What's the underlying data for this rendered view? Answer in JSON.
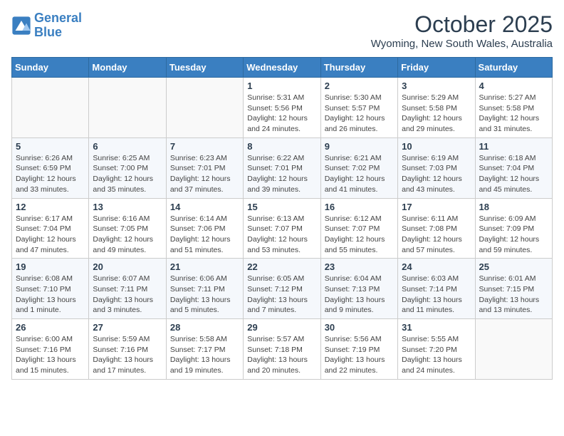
{
  "header": {
    "logo_line1": "General",
    "logo_line2": "Blue",
    "month": "October 2025",
    "location": "Wyoming, New South Wales, Australia"
  },
  "weekdays": [
    "Sunday",
    "Monday",
    "Tuesday",
    "Wednesday",
    "Thursday",
    "Friday",
    "Saturday"
  ],
  "weeks": [
    [
      {
        "day": "",
        "info": ""
      },
      {
        "day": "",
        "info": ""
      },
      {
        "day": "",
        "info": ""
      },
      {
        "day": "1",
        "info": "Sunrise: 5:31 AM\nSunset: 5:56 PM\nDaylight: 12 hours and 24 minutes."
      },
      {
        "day": "2",
        "info": "Sunrise: 5:30 AM\nSunset: 5:57 PM\nDaylight: 12 hours and 26 minutes."
      },
      {
        "day": "3",
        "info": "Sunrise: 5:29 AM\nSunset: 5:58 PM\nDaylight: 12 hours and 29 minutes."
      },
      {
        "day": "4",
        "info": "Sunrise: 5:27 AM\nSunset: 5:58 PM\nDaylight: 12 hours and 31 minutes."
      }
    ],
    [
      {
        "day": "5",
        "info": "Sunrise: 6:26 AM\nSunset: 6:59 PM\nDaylight: 12 hours and 33 minutes."
      },
      {
        "day": "6",
        "info": "Sunrise: 6:25 AM\nSunset: 7:00 PM\nDaylight: 12 hours and 35 minutes."
      },
      {
        "day": "7",
        "info": "Sunrise: 6:23 AM\nSunset: 7:01 PM\nDaylight: 12 hours and 37 minutes."
      },
      {
        "day": "8",
        "info": "Sunrise: 6:22 AM\nSunset: 7:01 PM\nDaylight: 12 hours and 39 minutes."
      },
      {
        "day": "9",
        "info": "Sunrise: 6:21 AM\nSunset: 7:02 PM\nDaylight: 12 hours and 41 minutes."
      },
      {
        "day": "10",
        "info": "Sunrise: 6:19 AM\nSunset: 7:03 PM\nDaylight: 12 hours and 43 minutes."
      },
      {
        "day": "11",
        "info": "Sunrise: 6:18 AM\nSunset: 7:04 PM\nDaylight: 12 hours and 45 minutes."
      }
    ],
    [
      {
        "day": "12",
        "info": "Sunrise: 6:17 AM\nSunset: 7:04 PM\nDaylight: 12 hours and 47 minutes."
      },
      {
        "day": "13",
        "info": "Sunrise: 6:16 AM\nSunset: 7:05 PM\nDaylight: 12 hours and 49 minutes."
      },
      {
        "day": "14",
        "info": "Sunrise: 6:14 AM\nSunset: 7:06 PM\nDaylight: 12 hours and 51 minutes."
      },
      {
        "day": "15",
        "info": "Sunrise: 6:13 AM\nSunset: 7:07 PM\nDaylight: 12 hours and 53 minutes."
      },
      {
        "day": "16",
        "info": "Sunrise: 6:12 AM\nSunset: 7:07 PM\nDaylight: 12 hours and 55 minutes."
      },
      {
        "day": "17",
        "info": "Sunrise: 6:11 AM\nSunset: 7:08 PM\nDaylight: 12 hours and 57 minutes."
      },
      {
        "day": "18",
        "info": "Sunrise: 6:09 AM\nSunset: 7:09 PM\nDaylight: 12 hours and 59 minutes."
      }
    ],
    [
      {
        "day": "19",
        "info": "Sunrise: 6:08 AM\nSunset: 7:10 PM\nDaylight: 13 hours and 1 minute."
      },
      {
        "day": "20",
        "info": "Sunrise: 6:07 AM\nSunset: 7:11 PM\nDaylight: 13 hours and 3 minutes."
      },
      {
        "day": "21",
        "info": "Sunrise: 6:06 AM\nSunset: 7:11 PM\nDaylight: 13 hours and 5 minutes."
      },
      {
        "day": "22",
        "info": "Sunrise: 6:05 AM\nSunset: 7:12 PM\nDaylight: 13 hours and 7 minutes."
      },
      {
        "day": "23",
        "info": "Sunrise: 6:04 AM\nSunset: 7:13 PM\nDaylight: 13 hours and 9 minutes."
      },
      {
        "day": "24",
        "info": "Sunrise: 6:03 AM\nSunset: 7:14 PM\nDaylight: 13 hours and 11 minutes."
      },
      {
        "day": "25",
        "info": "Sunrise: 6:01 AM\nSunset: 7:15 PM\nDaylight: 13 hours and 13 minutes."
      }
    ],
    [
      {
        "day": "26",
        "info": "Sunrise: 6:00 AM\nSunset: 7:16 PM\nDaylight: 13 hours and 15 minutes."
      },
      {
        "day": "27",
        "info": "Sunrise: 5:59 AM\nSunset: 7:16 PM\nDaylight: 13 hours and 17 minutes."
      },
      {
        "day": "28",
        "info": "Sunrise: 5:58 AM\nSunset: 7:17 PM\nDaylight: 13 hours and 19 minutes."
      },
      {
        "day": "29",
        "info": "Sunrise: 5:57 AM\nSunset: 7:18 PM\nDaylight: 13 hours and 20 minutes."
      },
      {
        "day": "30",
        "info": "Sunrise: 5:56 AM\nSunset: 7:19 PM\nDaylight: 13 hours and 22 minutes."
      },
      {
        "day": "31",
        "info": "Sunrise: 5:55 AM\nSunset: 7:20 PM\nDaylight: 13 hours and 24 minutes."
      },
      {
        "day": "",
        "info": ""
      }
    ]
  ]
}
